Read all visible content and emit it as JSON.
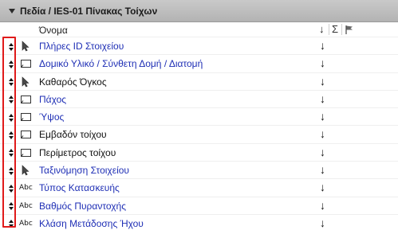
{
  "panel": {
    "title": "Πεδία / IES-01 Πίνακας Τοίχων"
  },
  "columns": {
    "name": "Όνομα",
    "sort_symbol": "↓",
    "sum_symbol": "Σ"
  },
  "rows": [
    {
      "label": "Πλήρες ID Στοιχείου",
      "icon": "pointer-arrow-icon",
      "style": "link",
      "sort": "↓"
    },
    {
      "label": "Δομικό Υλικό / Σύνθετη Δομή / Διατομή",
      "icon": "parameter-box-icon",
      "style": "link",
      "sort": "↓"
    },
    {
      "label": "Καθαρός Όγκος",
      "icon": "pointer-arrow-icon",
      "style": "plain",
      "sort": "↓"
    },
    {
      "label": "Πάχος",
      "icon": "parameter-box-icon",
      "style": "link",
      "sort": "↓"
    },
    {
      "label": "Ύψος",
      "icon": "parameter-box-icon",
      "style": "link",
      "sort": "↓"
    },
    {
      "label": "Εμβαδόν τοίχου",
      "icon": "parameter-box-icon",
      "style": "plain",
      "sort": "↓"
    },
    {
      "label": "Περίμετρος τοίχου",
      "icon": "parameter-box-icon",
      "style": "plain",
      "sort": "↓"
    },
    {
      "label": "Ταξινόμηση Στοιχείου",
      "icon": "pointer-arrow-icon",
      "style": "link",
      "sort": "↓"
    },
    {
      "label": "Τύπος Κατασκευής",
      "icon": "abc-text-icon",
      "icon_text": "Abc",
      "style": "link",
      "sort": "↓"
    },
    {
      "label": "Βαθμός Πυραντοχής",
      "icon": "abc-text-icon",
      "icon_text": "Abc",
      "style": "link",
      "sort": "↓"
    },
    {
      "label": "Κλάση Μετάδοσης Ήχου",
      "icon": "abc-text-icon",
      "icon_text": "Abc",
      "style": "link",
      "sort": "↓"
    }
  ],
  "colors": {
    "header_bg": "#bdbdbd",
    "link_text": "#1f2fb5",
    "highlight_border": "#e01b1b"
  }
}
